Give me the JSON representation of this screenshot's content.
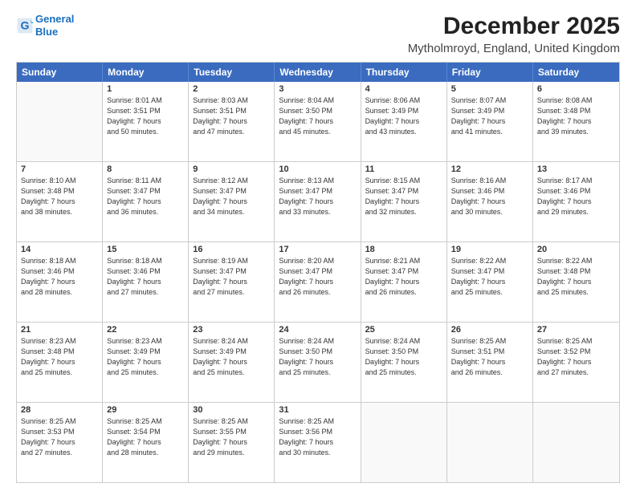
{
  "header": {
    "logo_line1": "General",
    "logo_line2": "Blue",
    "title": "December 2025",
    "subtitle": "Mytholmroyd, England, United Kingdom"
  },
  "weekdays": [
    "Sunday",
    "Monday",
    "Tuesday",
    "Wednesday",
    "Thursday",
    "Friday",
    "Saturday"
  ],
  "weeks": [
    [
      {
        "day": "",
        "lines": []
      },
      {
        "day": "1",
        "lines": [
          "Sunrise: 8:01 AM",
          "Sunset: 3:51 PM",
          "Daylight: 7 hours",
          "and 50 minutes."
        ]
      },
      {
        "day": "2",
        "lines": [
          "Sunrise: 8:03 AM",
          "Sunset: 3:51 PM",
          "Daylight: 7 hours",
          "and 47 minutes."
        ]
      },
      {
        "day": "3",
        "lines": [
          "Sunrise: 8:04 AM",
          "Sunset: 3:50 PM",
          "Daylight: 7 hours",
          "and 45 minutes."
        ]
      },
      {
        "day": "4",
        "lines": [
          "Sunrise: 8:06 AM",
          "Sunset: 3:49 PM",
          "Daylight: 7 hours",
          "and 43 minutes."
        ]
      },
      {
        "day": "5",
        "lines": [
          "Sunrise: 8:07 AM",
          "Sunset: 3:49 PM",
          "Daylight: 7 hours",
          "and 41 minutes."
        ]
      },
      {
        "day": "6",
        "lines": [
          "Sunrise: 8:08 AM",
          "Sunset: 3:48 PM",
          "Daylight: 7 hours",
          "and 39 minutes."
        ]
      }
    ],
    [
      {
        "day": "7",
        "lines": [
          "Sunrise: 8:10 AM",
          "Sunset: 3:48 PM",
          "Daylight: 7 hours",
          "and 38 minutes."
        ]
      },
      {
        "day": "8",
        "lines": [
          "Sunrise: 8:11 AM",
          "Sunset: 3:47 PM",
          "Daylight: 7 hours",
          "and 36 minutes."
        ]
      },
      {
        "day": "9",
        "lines": [
          "Sunrise: 8:12 AM",
          "Sunset: 3:47 PM",
          "Daylight: 7 hours",
          "and 34 minutes."
        ]
      },
      {
        "day": "10",
        "lines": [
          "Sunrise: 8:13 AM",
          "Sunset: 3:47 PM",
          "Daylight: 7 hours",
          "and 33 minutes."
        ]
      },
      {
        "day": "11",
        "lines": [
          "Sunrise: 8:15 AM",
          "Sunset: 3:47 PM",
          "Daylight: 7 hours",
          "and 32 minutes."
        ]
      },
      {
        "day": "12",
        "lines": [
          "Sunrise: 8:16 AM",
          "Sunset: 3:46 PM",
          "Daylight: 7 hours",
          "and 30 minutes."
        ]
      },
      {
        "day": "13",
        "lines": [
          "Sunrise: 8:17 AM",
          "Sunset: 3:46 PM",
          "Daylight: 7 hours",
          "and 29 minutes."
        ]
      }
    ],
    [
      {
        "day": "14",
        "lines": [
          "Sunrise: 8:18 AM",
          "Sunset: 3:46 PM",
          "Daylight: 7 hours",
          "and 28 minutes."
        ]
      },
      {
        "day": "15",
        "lines": [
          "Sunrise: 8:18 AM",
          "Sunset: 3:46 PM",
          "Daylight: 7 hours",
          "and 27 minutes."
        ]
      },
      {
        "day": "16",
        "lines": [
          "Sunrise: 8:19 AM",
          "Sunset: 3:47 PM",
          "Daylight: 7 hours",
          "and 27 minutes."
        ]
      },
      {
        "day": "17",
        "lines": [
          "Sunrise: 8:20 AM",
          "Sunset: 3:47 PM",
          "Daylight: 7 hours",
          "and 26 minutes."
        ]
      },
      {
        "day": "18",
        "lines": [
          "Sunrise: 8:21 AM",
          "Sunset: 3:47 PM",
          "Daylight: 7 hours",
          "and 26 minutes."
        ]
      },
      {
        "day": "19",
        "lines": [
          "Sunrise: 8:22 AM",
          "Sunset: 3:47 PM",
          "Daylight: 7 hours",
          "and 25 minutes."
        ]
      },
      {
        "day": "20",
        "lines": [
          "Sunrise: 8:22 AM",
          "Sunset: 3:48 PM",
          "Daylight: 7 hours",
          "and 25 minutes."
        ]
      }
    ],
    [
      {
        "day": "21",
        "lines": [
          "Sunrise: 8:23 AM",
          "Sunset: 3:48 PM",
          "Daylight: 7 hours",
          "and 25 minutes."
        ]
      },
      {
        "day": "22",
        "lines": [
          "Sunrise: 8:23 AM",
          "Sunset: 3:49 PM",
          "Daylight: 7 hours",
          "and 25 minutes."
        ]
      },
      {
        "day": "23",
        "lines": [
          "Sunrise: 8:24 AM",
          "Sunset: 3:49 PM",
          "Daylight: 7 hours",
          "and 25 minutes."
        ]
      },
      {
        "day": "24",
        "lines": [
          "Sunrise: 8:24 AM",
          "Sunset: 3:50 PM",
          "Daylight: 7 hours",
          "and 25 minutes."
        ]
      },
      {
        "day": "25",
        "lines": [
          "Sunrise: 8:24 AM",
          "Sunset: 3:50 PM",
          "Daylight: 7 hours",
          "and 25 minutes."
        ]
      },
      {
        "day": "26",
        "lines": [
          "Sunrise: 8:25 AM",
          "Sunset: 3:51 PM",
          "Daylight: 7 hours",
          "and 26 minutes."
        ]
      },
      {
        "day": "27",
        "lines": [
          "Sunrise: 8:25 AM",
          "Sunset: 3:52 PM",
          "Daylight: 7 hours",
          "and 27 minutes."
        ]
      }
    ],
    [
      {
        "day": "28",
        "lines": [
          "Sunrise: 8:25 AM",
          "Sunset: 3:53 PM",
          "Daylight: 7 hours",
          "and 27 minutes."
        ]
      },
      {
        "day": "29",
        "lines": [
          "Sunrise: 8:25 AM",
          "Sunset: 3:54 PM",
          "Daylight: 7 hours",
          "and 28 minutes."
        ]
      },
      {
        "day": "30",
        "lines": [
          "Sunrise: 8:25 AM",
          "Sunset: 3:55 PM",
          "Daylight: 7 hours",
          "and 29 minutes."
        ]
      },
      {
        "day": "31",
        "lines": [
          "Sunrise: 8:25 AM",
          "Sunset: 3:56 PM",
          "Daylight: 7 hours",
          "and 30 minutes."
        ]
      },
      {
        "day": "",
        "lines": []
      },
      {
        "day": "",
        "lines": []
      },
      {
        "day": "",
        "lines": []
      }
    ]
  ]
}
